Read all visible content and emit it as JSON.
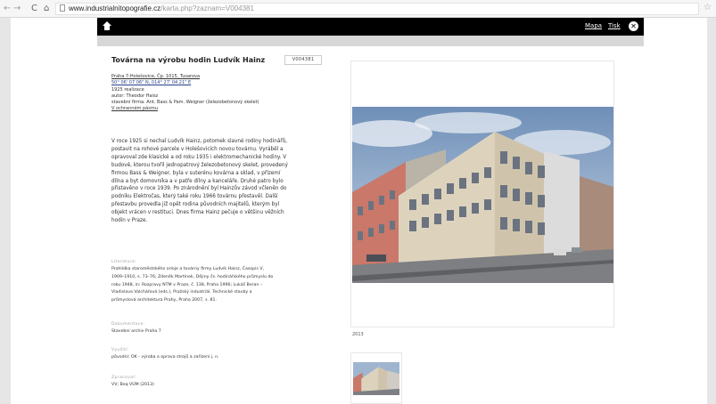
{
  "browser": {
    "back_icon": "←",
    "forward_icon": "→",
    "reload_icon": "C",
    "home_icon": "⌂",
    "url_domain": "www.industrialnitopografie.cz",
    "url_path": "/karta.php?zaznam=V004381",
    "star_icon": "☆"
  },
  "header": {
    "map_label": "Mapa",
    "print_label": "Tisk",
    "close_icon": "✕"
  },
  "record": {
    "title": "Továrna na výrobu hodin Ludvík Hainz",
    "id": "V004381",
    "details": [
      "Praha 7-Holešovice, Čp. 1015, Tusarova",
      "50° 06' 07.06\" N, 014° 27' 04.21\" E",
      "1925 realizace",
      "autor: Theodor Haisz",
      "stavební firma: Ant. Bass & Pam. Weigner (železobetonový skelet)",
      "V ochranném pásmu"
    ],
    "description": [
      "V roce 1925 si nechal Ludvík Hainz, potomek slavné rodiny hodinářů,",
      "postavit na rohové parcele v Holešovicích novou továrnu. Vyráběl a",
      "opravoval zde klasické a od roku 1935 i elektromechanické hodiny. V",
      "budově, kterou tvořil jednopatrový železobetonový skelet, provedený",
      "firmou Bass & Weigner, byla v suterénu kovárna a sklad, v přízemí",
      "dílna a byt domovníka a v patře dílny a kanceláře. Druhé patro bylo",
      "přistavěno v roce 1939. Po znárodnění byl Hainzův závod včleněn do",
      "podniku Elektročas, který také roku 1966 továrnu přestavěl. Další",
      "přestavbu provedla již opět rodina původních majitelů, kterým byl",
      "objekt vrácen v restituci. Dnes firma Hainz pečuje o většinu věžních",
      "hodin v Praze."
    ],
    "literature_label": "Literatura:",
    "literature": [
      "Prohlídka staroměstského orloje a továrny firmy Ludvík Hainz, Časopis V,",
      "1909–1910, s. 73–76; Zdeněk Martínek, Dějiny čs. hodinářského průmyslu do",
      "roku 1948, in: Rozpravy NTM v Praze, č. 138, Praha 1996; Lukáš Beran –",
      "Vladislava Valchářová (eds.), Pražský industriál. Technické stavby a",
      "průmyslová architektura Prahy, Praha 2007, s. 81."
    ],
    "documentation_label": "Dokumentace:",
    "documentation": [
      "Stavební archiv Praha 7"
    ],
    "usage_label": "Využití:",
    "usage": [
      "původní: OK - výroba a oprava strojů a zařízení j. n."
    ],
    "authors_label": "Zpracoval:",
    "authors": [
      "VV; Beq VÚM (2013)"
    ],
    "photo_caption": "2013"
  },
  "colors": {
    "header_bg": "#000000",
    "subbar_bg": "#d7d7d7",
    "link": "#2a3f8a",
    "label": "#a0a0a0"
  }
}
